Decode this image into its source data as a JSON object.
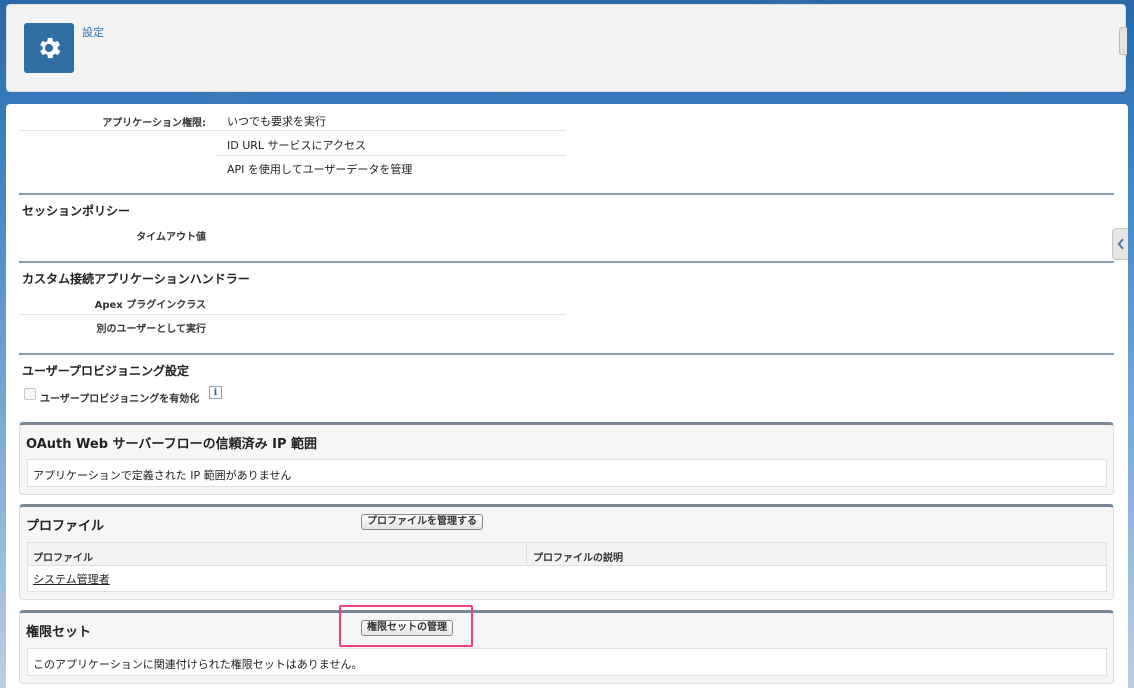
{
  "header": {
    "title": "設定",
    "icon": "gear-icon"
  },
  "app_permissions": {
    "label": "アプリケーション権限:",
    "values": [
      "いつでも要求を実行",
      "ID URL サービスにアクセス",
      "API を使用してユーザーデータを管理"
    ]
  },
  "session_policy": {
    "title": "セッションポリシー",
    "timeout_label": "タイムアウト値"
  },
  "custom_handler": {
    "title": "カスタム接続アプリケーションハンドラー",
    "apex_label": "Apex プラグインクラス",
    "run_as_label": "別のユーザーとして実行"
  },
  "user_provisioning": {
    "title": "ユーザープロビジョニング設定",
    "checkbox_label": "ユーザープロビジョニングを有効化"
  },
  "oauth_ip": {
    "title": "OAuth Web サーバーフローの信頼済み IP 範囲",
    "empty_message": "アプリケーションで定義された IP 範囲がありません"
  },
  "profiles": {
    "title": "プロファイル",
    "manage_button": "プロファイルを管理する",
    "columns": [
      "プロファイル",
      "プロファイルの説明"
    ],
    "rows": [
      {
        "name": "システム管理者",
        "description": ""
      }
    ]
  },
  "permission_sets": {
    "title": "権限セット",
    "manage_button": "権限セットの管理",
    "empty_message": "このアプリケーションに関連付けられた権限セットはありません。"
  },
  "colors": {
    "accent": "#2f6fa6",
    "highlight": "#f0407e"
  }
}
